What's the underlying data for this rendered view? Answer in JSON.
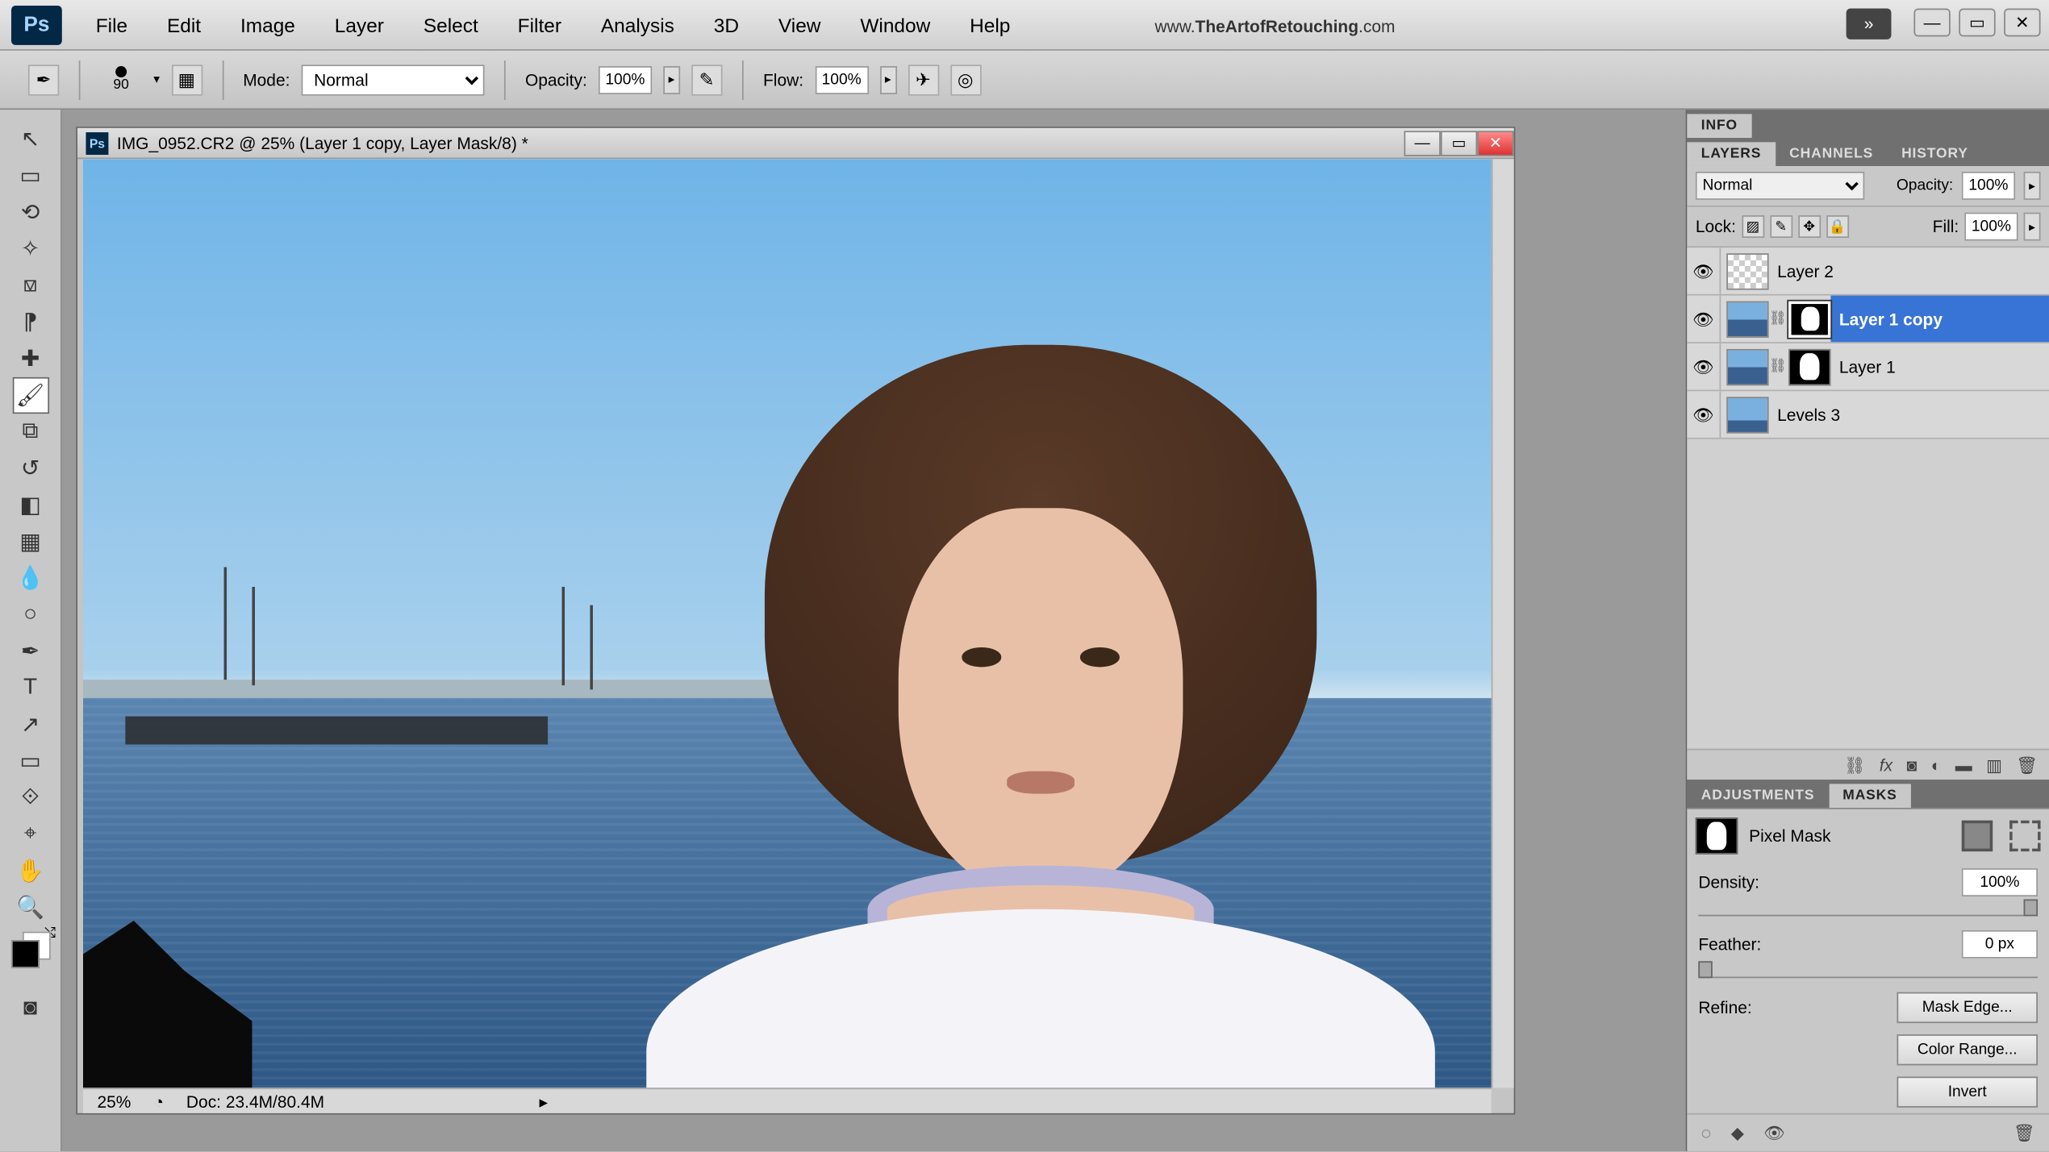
{
  "menubar": {
    "items": [
      "File",
      "Edit",
      "Image",
      "Layer",
      "Select",
      "Filter",
      "Analysis",
      "3D",
      "View",
      "Window",
      "Help"
    ],
    "brand_prefix": "www.",
    "brand_main": "TheArtofRetouching",
    "brand_suffix": ".com"
  },
  "options_bar": {
    "brush_size": "90",
    "mode_label": "Mode:",
    "mode_value": "Normal",
    "opacity_label": "Opacity:",
    "opacity_value": "100%",
    "flow_label": "Flow:",
    "flow_value": "100%"
  },
  "document": {
    "title": "IMG_0952.CR2 @ 25% (Layer 1 copy, Layer Mask/8) *",
    "zoom": "25%",
    "doc_size": "Doc: 23.4M/80.4M"
  },
  "info_panel": {
    "tab": "INFO"
  },
  "layers_panel": {
    "tabs": [
      "LAYERS",
      "CHANNELS",
      "HISTORY"
    ],
    "blend_mode": "Normal",
    "opacity_label": "Opacity:",
    "opacity_value": "100%",
    "lock_label": "Lock:",
    "fill_label": "Fill:",
    "fill_value": "100%",
    "layers": [
      {
        "name": "Layer 2",
        "visible": true,
        "has_mask": false,
        "thumb": "checker",
        "active": false
      },
      {
        "name": "Layer 1 copy",
        "visible": true,
        "has_mask": true,
        "thumb": "img",
        "active": true
      },
      {
        "name": "Layer 1",
        "visible": true,
        "has_mask": true,
        "thumb": "img",
        "active": false
      },
      {
        "name": "Levels 3",
        "visible": true,
        "has_mask": false,
        "thumb": "sky",
        "active": false
      }
    ]
  },
  "masks_panel": {
    "tabs": [
      "ADJUSTMENTS",
      "MASKS"
    ],
    "mask_type": "Pixel Mask",
    "density_label": "Density:",
    "density_value": "100%",
    "feather_label": "Feather:",
    "feather_value": "0 px",
    "refine_label": "Refine:",
    "mask_edge_btn": "Mask Edge...",
    "color_range_btn": "Color Range...",
    "invert_btn": "Invert"
  }
}
